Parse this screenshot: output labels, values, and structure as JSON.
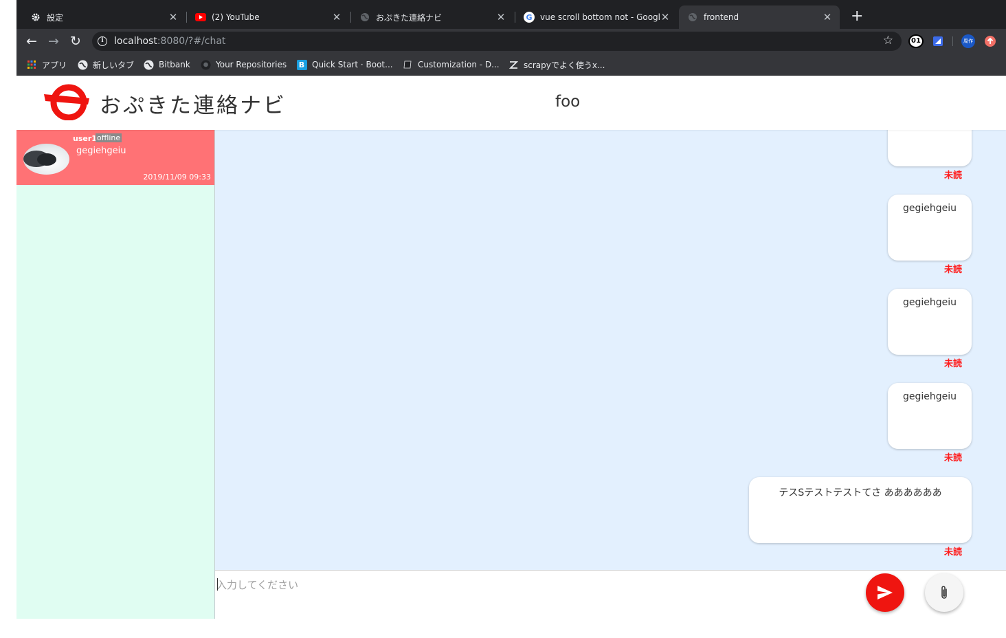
{
  "browser": {
    "tabs": [
      {
        "title": "設定",
        "icon": "gear-icon"
      },
      {
        "title": "(2) YouTube",
        "icon": "youtube-icon"
      },
      {
        "title": "おぷきた連絡ナビ",
        "icon": "globe-icon"
      },
      {
        "title": "vue scroll bottom not - Google",
        "icon": "google-icon"
      },
      {
        "title": "frontend",
        "icon": "globe-icon"
      }
    ],
    "new_tab_label": "+",
    "address": {
      "host": "localhost",
      "path": ":8080/?#/chat"
    },
    "extensions": {
      "counter": "01",
      "ext_label": "周作"
    },
    "bookmarks": [
      {
        "label": "アプリ",
        "icon": "apps-grid-icon"
      },
      {
        "label": "新しいタブ",
        "icon": "globe-icon"
      },
      {
        "label": "Bitbank",
        "icon": "globe-icon"
      },
      {
        "label": "Your Repositories",
        "icon": "github-icon"
      },
      {
        "label": "Quick Start · Boot...",
        "icon": "bootstrap-icon"
      },
      {
        "label": "Customization - D...",
        "icon": "book-icon"
      },
      {
        "label": "scrapyでよく使うx...",
        "icon": "zenn-icon"
      }
    ]
  },
  "app": {
    "name": "おぷきた連絡ナビ",
    "room_title": "foo",
    "accent": "#ef1510"
  },
  "rooms": [
    {
      "user": "user1",
      "status": "offline",
      "last_message": "gegiehgeiu",
      "time": "2019/11/09 09:33"
    }
  ],
  "messages": [
    {
      "text": "",
      "status": "未読"
    },
    {
      "text": "gegiehgeiu",
      "status": "未読"
    },
    {
      "text": "gegiehgeiu",
      "status": "未読"
    },
    {
      "text": "gegiehgeiu",
      "status": "未読"
    },
    {
      "text": "テスSテストテストてさ ああああああ",
      "status": "未読"
    }
  ],
  "composer": {
    "placeholder": "入力してください"
  }
}
